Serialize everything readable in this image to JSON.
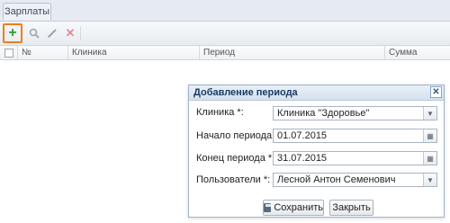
{
  "tabs": [
    {
      "label": "Зарплаты"
    }
  ],
  "toolbar": {
    "add_icon": "plus-icon",
    "search_icon": "search-icon",
    "edit_icon": "pencil-icon",
    "delete_icon": "close-icon"
  },
  "grid": {
    "columns": [
      "№",
      "Клиника",
      "Период",
      "Сумма"
    ]
  },
  "dialog": {
    "title": "Добавление периода",
    "fields": [
      {
        "label": "Клиника *:",
        "value": "Клиника \"Здоровье\"",
        "type": "select"
      },
      {
        "label": "Начало периода *:",
        "value": "01.07.2015",
        "type": "date"
      },
      {
        "label": "Конец периода *:",
        "value": "31.07.2015",
        "type": "date"
      },
      {
        "label": "Пользователи *:",
        "value": "Лесной Антон Семенович",
        "type": "select"
      }
    ],
    "save_label": "Сохранить",
    "close_label": "Закрыть"
  },
  "colors": {
    "accent_highlight": "#f27c1b",
    "dialog_title": "#1b3b64"
  }
}
